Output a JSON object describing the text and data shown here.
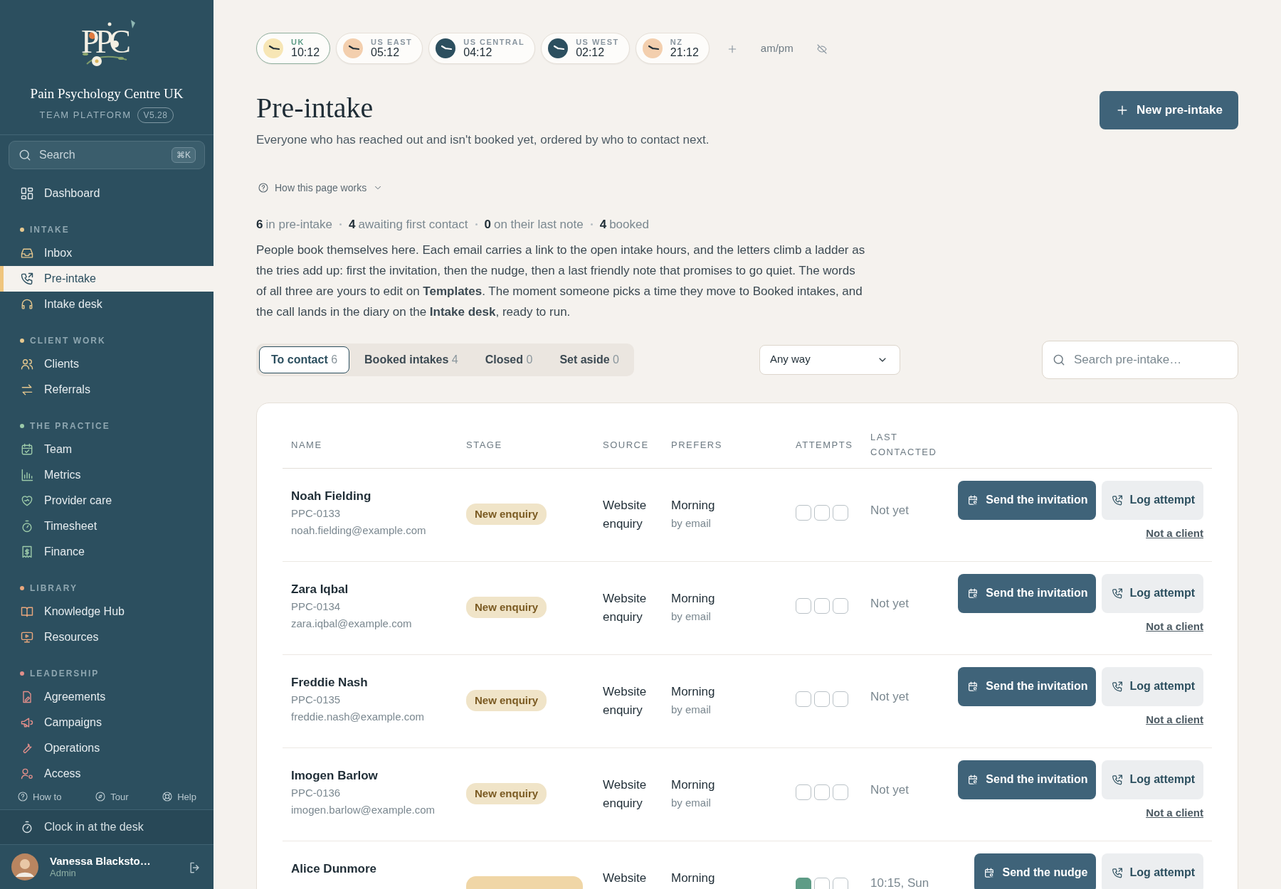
{
  "sidebar": {
    "brand": {
      "logo_text": "PPC",
      "name": "Pain Psychology Centre UK",
      "subtitle": "TEAM PLATFORM",
      "version": "V5.28"
    },
    "search": {
      "placeholder": "Search",
      "shortcut": "⌘K"
    },
    "top_items": [
      {
        "label": "Dashboard",
        "selected": false
      }
    ],
    "sections": [
      {
        "title": "INTAKE",
        "color": "#e6c88f",
        "items": [
          {
            "label": "Inbox",
            "selected": false
          },
          {
            "label": "Pre-intake",
            "selected": true
          },
          {
            "label": "Intake desk",
            "selected": false
          }
        ]
      },
      {
        "title": "CLIENT WORK",
        "color": "#e6c88f",
        "items": [
          {
            "label": "Clients",
            "selected": false
          },
          {
            "label": "Referrals",
            "selected": false
          }
        ]
      },
      {
        "title": "THE PRACTICE",
        "color": "#9ccaa9",
        "items": [
          {
            "label": "Team",
            "selected": false
          },
          {
            "label": "Metrics",
            "selected": false
          },
          {
            "label": "Provider care",
            "selected": false
          },
          {
            "label": "Timesheet",
            "selected": false
          },
          {
            "label": "Finance",
            "selected": false
          }
        ]
      },
      {
        "title": "LIBRARY",
        "color": "#e9a77d",
        "items": [
          {
            "label": "Knowledge Hub",
            "selected": false
          },
          {
            "label": "Resources",
            "selected": false
          }
        ]
      },
      {
        "title": "LEADERSHIP",
        "color": "#e08e8a",
        "items": [
          {
            "label": "Agreements",
            "selected": false
          },
          {
            "label": "Campaigns",
            "selected": false
          },
          {
            "label": "Operations",
            "selected": false
          },
          {
            "label": "Access",
            "selected": false
          }
        ]
      }
    ],
    "footer_links": [
      "How to",
      "Tour",
      "Help"
    ],
    "clock_in": "Clock in at the desk",
    "user": {
      "name": "Vanessa Blacksto…",
      "role": "Admin"
    }
  },
  "clocks": [
    {
      "zone": "UK",
      "time": "10:12",
      "color": "#f7e6b5",
      "selected": true
    },
    {
      "zone": "US EAST",
      "time": "05:12",
      "color": "#f3cfae",
      "selected": false
    },
    {
      "zone": "US CENTRAL",
      "time": "04:12",
      "color": "#2c4f5f",
      "selected": false
    },
    {
      "zone": "US WEST",
      "time": "02:12",
      "color": "#2c4f5f",
      "selected": false
    },
    {
      "zone": "NZ",
      "time": "21:12",
      "color": "#f3cfae",
      "selected": false
    }
  ],
  "clock_format": "am/pm",
  "page": {
    "title": "Pre-intake",
    "subtitle": "Everyone who has reached out and isn't booked yet, ordered by who to contact next.",
    "new_button": "New pre-intake",
    "help_toggle": "How this page works",
    "stats": [
      {
        "count": "6",
        "text": "in pre-intake"
      },
      {
        "count": "4",
        "text": "awaiting first contact"
      },
      {
        "count": "0",
        "text": "on their last note"
      },
      {
        "count": "4",
        "text": "booked"
      }
    ],
    "explainer": [
      {
        "text": "People book themselves here. Each email carries a link to the open intake hours, and the letters climb a ladder as the tries add up: first the invitation, then the nudge, then a last friendly note that promises to go quiet. The words of all three are yours to edit on "
      },
      {
        "link": "Templates"
      },
      {
        "text": ". The moment someone picks a time they move to Booked intakes, and the call lands in the diary on the "
      },
      {
        "link": "Intake desk"
      },
      {
        "text": ", ready to run."
      }
    ]
  },
  "tabs": [
    {
      "label": "To contact",
      "count": "6",
      "selected": true
    },
    {
      "label": "Booked intakes",
      "count": "4",
      "selected": false
    },
    {
      "label": "Closed",
      "count": "0",
      "selected": false
    },
    {
      "label": "Set aside",
      "count": "0",
      "selected": false
    }
  ],
  "filter": {
    "value": "Any way"
  },
  "search": {
    "placeholder": "Search pre-intake…"
  },
  "table": {
    "columns": [
      "NAME",
      "STAGE",
      "SOURCE",
      "PREFERS",
      "ATTEMPTS",
      "LAST CONTACTED"
    ],
    "rows": [
      {
        "name": "Noah Fielding",
        "ref": "PPC-0133",
        "email": "noah.fielding@example.com",
        "stage": {
          "label": "New enquiry",
          "color": "#f0e4c8"
        },
        "source": "Website enquiry",
        "prefers": "Morning",
        "prefers_note": "by email",
        "attempts": [
          {
            "checked": false
          },
          {
            "checked": false
          },
          {
            "checked": false
          }
        ],
        "last_contacted": "Not yet",
        "primary_action": "Send the invitation",
        "secondary_action": "Log attempt",
        "dismiss": "Not a client"
      },
      {
        "name": "Zara Iqbal",
        "ref": "PPC-0134",
        "email": "zara.iqbal@example.com",
        "stage": {
          "label": "New enquiry",
          "color": "#f0e4c8"
        },
        "source": "Website enquiry",
        "prefers": "Morning",
        "prefers_note": "by email",
        "attempts": [
          {
            "checked": false
          },
          {
            "checked": false
          },
          {
            "checked": false
          }
        ],
        "last_contacted": "Not yet",
        "primary_action": "Send the invitation",
        "secondary_action": "Log attempt",
        "dismiss": "Not a client"
      },
      {
        "name": "Freddie Nash",
        "ref": "PPC-0135",
        "email": "freddie.nash@example.com",
        "stage": {
          "label": "New enquiry",
          "color": "#f0e4c8"
        },
        "source": "Website enquiry",
        "prefers": "Morning",
        "prefers_note": "by email",
        "attempts": [
          {
            "checked": false
          },
          {
            "checked": false
          },
          {
            "checked": false
          }
        ],
        "last_contacted": "Not yet",
        "primary_action": "Send the invitation",
        "secondary_action": "Log attempt",
        "dismiss": "Not a client"
      },
      {
        "name": "Imogen Barlow",
        "ref": "PPC-0136",
        "email": "imogen.barlow@example.com",
        "stage": {
          "label": "New enquiry",
          "color": "#f0e4c8"
        },
        "source": "Website enquiry",
        "prefers": "Morning",
        "prefers_note": "by email",
        "attempts": [
          {
            "checked": false
          },
          {
            "checked": false
          },
          {
            "checked": false
          }
        ],
        "last_contacted": "Not yet",
        "primary_action": "Send the invitation",
        "secondary_action": "Log attempt",
        "dismiss": "Not a client"
      },
      {
        "name": "Alice Dunmore",
        "stage": {
          "color": "#f0d6a6"
        },
        "source": "Website",
        "prefers": "Morning",
        "attempts": [
          {
            "checked": true
          },
          {
            "checked": false
          },
          {
            "checked": false
          }
        ],
        "last_contacted": "10:15, Sun",
        "primary_action": "Send the nudge",
        "secondary_action": "Log attempt"
      }
    ]
  }
}
